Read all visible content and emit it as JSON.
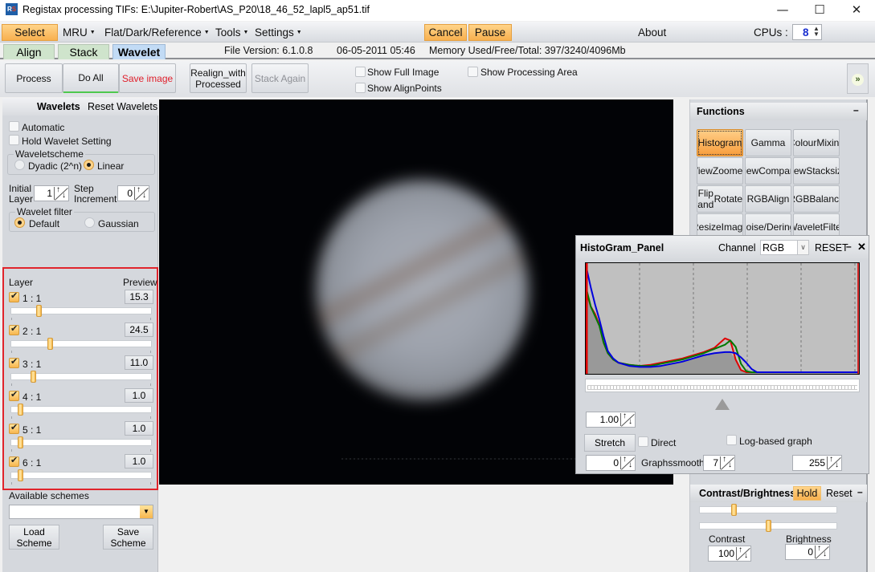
{
  "window": {
    "title": "Registax processing TIFs: E:\\Jupiter-Robert\\AS_P20\\18_46_52_lapl5_ap51.tif",
    "icon": "registax-app-icon",
    "controls": {
      "minimize": "—",
      "maximize": "☐",
      "close": "✕"
    }
  },
  "menubar": {
    "select": "Select",
    "mru": "MRU",
    "flat_dark_reference": "Flat/Dark/Reference",
    "tools": "Tools",
    "settings": "Settings",
    "cancel": "Cancel",
    "pause": "Pause",
    "about": "About",
    "cpus_label": "CPUs :",
    "cpus_value": "8",
    "caret": "▼"
  },
  "tabs": [
    {
      "label": "Align",
      "active": false
    },
    {
      "label": "Stack",
      "active": false
    },
    {
      "label": "Wavelet",
      "active": true
    }
  ],
  "status": {
    "file_version": "File Version: 6.1.0.8",
    "datetime": "06-05-2011 05:46",
    "memory": "Memory Used/Free/Total: 397/3240/4096Mb"
  },
  "toolbar": {
    "process": "Process",
    "do_all": "Do All",
    "save_image": "Save image",
    "realign_line1": "Realign_with",
    "realign_line2": "Processed",
    "stack_again": "Stack Again",
    "show_full_image": "Show Full Image",
    "show_alignpoints": "Show AlignPoints",
    "show_processing_area": "Show Processing Area",
    "expand_icon": "»"
  },
  "wavelets": {
    "title": "Wavelets",
    "reset": "Reset Wavelets",
    "automatic": {
      "label": "Automatic",
      "checked": false
    },
    "hold_setting": {
      "label": "Hold Wavelet Setting",
      "checked": false
    },
    "scheme_group": "Waveletscheme",
    "scheme_options": [
      {
        "label": "Dyadic (2^n)",
        "selected": false
      },
      {
        "label": "Linear",
        "selected": true
      }
    ],
    "initial_layer_label1": "Initial",
    "initial_layer_label2": "Layer",
    "initial_layer_value": "1",
    "step_increment_label1": "Step",
    "step_increment_label2": "Increment",
    "step_increment_value": "0",
    "filter_group": "Wavelet filter",
    "filter_options": [
      {
        "label": "Default",
        "selected": true
      },
      {
        "label": "Gaussian",
        "selected": false
      }
    ],
    "layer_header": "Layer",
    "preview_header": "Preview",
    "layers": [
      {
        "label": "1 : 1",
        "checked": true,
        "value": "15.3",
        "slider_fraction": 0.2
      },
      {
        "label": "2 : 1",
        "checked": true,
        "value": "24.5",
        "slider_fraction": 0.28
      },
      {
        "label": "3 : 1",
        "checked": true,
        "value": "11.0",
        "slider_fraction": 0.16
      },
      {
        "label": "4 : 1",
        "checked": true,
        "value": "1.0",
        "slider_fraction": 0.07
      },
      {
        "label": "5 : 1",
        "checked": true,
        "value": "1.0",
        "slider_fraction": 0.07
      },
      {
        "label": "6 : 1",
        "checked": true,
        "value": "1.0",
        "slider_fraction": 0.07
      }
    ],
    "available_schemes": "Available schemes",
    "scheme_select_value": "",
    "load_scheme_1": "Load",
    "load_scheme_2": "Scheme",
    "save_scheme_1": "Save",
    "save_scheme_2": "Scheme"
  },
  "functions": {
    "title": "Functions",
    "collapse": "–",
    "buttons": [
      {
        "line1": "Histogram",
        "line2": "",
        "active": true
      },
      {
        "line1": "Gamma",
        "line2": "",
        "active": false
      },
      {
        "line1": "Colour",
        "line2": "Mixing",
        "active": false
      },
      {
        "line1": "View",
        "line2": "Zoomed",
        "active": false
      },
      {
        "line1": "View",
        "line2": "Compare",
        "active": false
      },
      {
        "line1": "View",
        "line2": "Stacksize",
        "active": false
      },
      {
        "line1": "Flip and",
        "line2": "Rotate",
        "active": false
      },
      {
        "line1": "RGB",
        "line2": "Align",
        "active": false
      },
      {
        "line1": "RGB",
        "line2": "Balance",
        "active": false
      },
      {
        "line1": "Resize",
        "line2": "Image",
        "active": false
      },
      {
        "line1": "Denoise/",
        "line2": "Deringing",
        "active": false
      },
      {
        "line1": "Wavelet",
        "line2": "Filter",
        "active": false
      }
    ]
  },
  "histogram": {
    "title": "HistoGram_Panel",
    "channel_label": "Channel",
    "channel_value": "RGB",
    "reset": "RESET",
    "minimize": "–",
    "close": "✕",
    "gamma_value": "1.00",
    "stretch": "Stretch",
    "direct": {
      "label": "Direct",
      "checked": false
    },
    "log_graph": {
      "label": "Log-based graph",
      "checked": false
    },
    "low_value": "0",
    "graphsmooth_label": "Graphssmooth",
    "graphsmooth_value": "7",
    "high_value": "255",
    "marker_fraction": 0.5,
    "colors": {
      "red": "#e00000",
      "green": "#007a00",
      "blue": "#0000dd"
    }
  },
  "chart_data": {
    "type": "line",
    "title": "HistoGram_Panel",
    "xlabel": "",
    "ylabel": "",
    "xlim": [
      0,
      255
    ],
    "ylim": [
      0,
      1
    ],
    "grid": "vertical-dashed",
    "x": [
      0,
      4,
      8,
      12,
      16,
      20,
      25,
      30,
      40,
      50,
      60,
      70,
      80,
      90,
      100,
      110,
      120,
      130,
      135,
      140,
      145,
      150,
      155,
      160,
      170,
      180,
      200,
      230,
      255
    ],
    "series": [
      {
        "name": "Red",
        "values": [
          0.75,
          0.62,
          0.55,
          0.45,
          0.28,
          0.18,
          0.12,
          0.09,
          0.07,
          0.06,
          0.07,
          0.09,
          0.11,
          0.13,
          0.16,
          0.19,
          0.23,
          0.32,
          0.3,
          0.12,
          0.02,
          0.0,
          0.0,
          0.0,
          0.0,
          0.0,
          0.0,
          0.0,
          0.0
        ]
      },
      {
        "name": "Green",
        "values": [
          0.78,
          0.62,
          0.53,
          0.44,
          0.28,
          0.18,
          0.12,
          0.09,
          0.07,
          0.06,
          0.06,
          0.08,
          0.1,
          0.12,
          0.15,
          0.18,
          0.22,
          0.26,
          0.3,
          0.24,
          0.08,
          0.01,
          0.0,
          0.0,
          0.0,
          0.0,
          0.0,
          0.0,
          0.0
        ]
      },
      {
        "name": "Blue",
        "values": [
          0.98,
          0.8,
          0.64,
          0.5,
          0.34,
          0.2,
          0.13,
          0.09,
          0.06,
          0.05,
          0.05,
          0.06,
          0.08,
          0.1,
          0.13,
          0.16,
          0.18,
          0.19,
          0.19,
          0.18,
          0.14,
          0.09,
          0.03,
          0.0,
          0.0,
          0.0,
          0.0,
          0.0,
          0.0
        ]
      }
    ]
  },
  "contrast_brightness": {
    "title": "Contrast/Brightness",
    "hold": "Hold",
    "reset": "Reset",
    "collapse": "–",
    "contrast_label": "Contrast",
    "contrast_value": "100",
    "brightness_label": "Brightness",
    "brightness_value": "0",
    "contrast_slider_fraction": 0.25,
    "brightness_slider_fraction": 0.5
  }
}
